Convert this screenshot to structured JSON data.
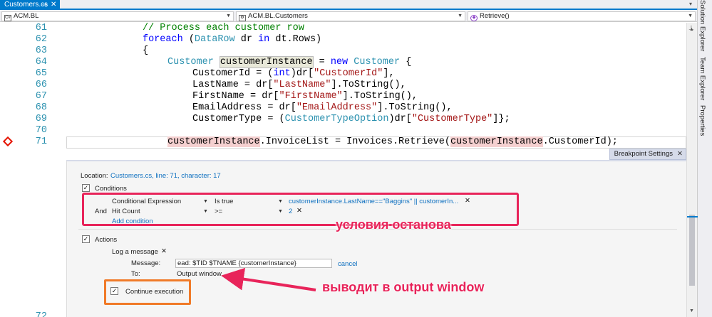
{
  "tab": {
    "title": "Customers.cs",
    "pin": "⊣",
    "close": "✕"
  },
  "nav": {
    "project": "ACM.BL",
    "class": "ACM.BL.Customers",
    "member": "Retrieve()"
  },
  "side_panels": [
    "Solution Explorer",
    "Team Explorer",
    "Properties"
  ],
  "code": {
    "line_numbers": [
      "61",
      "62",
      "63",
      "64",
      "65",
      "66",
      "67",
      "68",
      "69",
      "70",
      "71"
    ],
    "bottom_line_number": "72"
  },
  "breakpoint_settings": {
    "title": "Breakpoint Settings",
    "location_label": "Location:",
    "location_value": "Customers.cs, line: 71, character: 17",
    "conditions_label": "Conditions",
    "row1": {
      "type": "Conditional Expression",
      "op": "Is true",
      "value": "customerInstance.LastName==\"Baggins\" || customerIn..."
    },
    "row2": {
      "and": "And",
      "type": "Hit Count",
      "op": ">=",
      "value": "2"
    },
    "add_condition": "Add condition",
    "actions_label": "Actions",
    "log_message_label": "Log a message",
    "message_label": "Message:",
    "message_value": "ead: $TID $TNAME {customerInstance}",
    "cancel": "cancel",
    "to_label": "To:",
    "to_value": "Output window",
    "continue_label": "Continue execution"
  },
  "annotations": {
    "conditions_note": "условия останова",
    "output_note": "выводит в output window"
  },
  "colors": {
    "accent": "#007acc",
    "annotation_pink": "#e8245a",
    "annotation_orange": "#f07a28",
    "breakpoint_red": "#e51400"
  }
}
